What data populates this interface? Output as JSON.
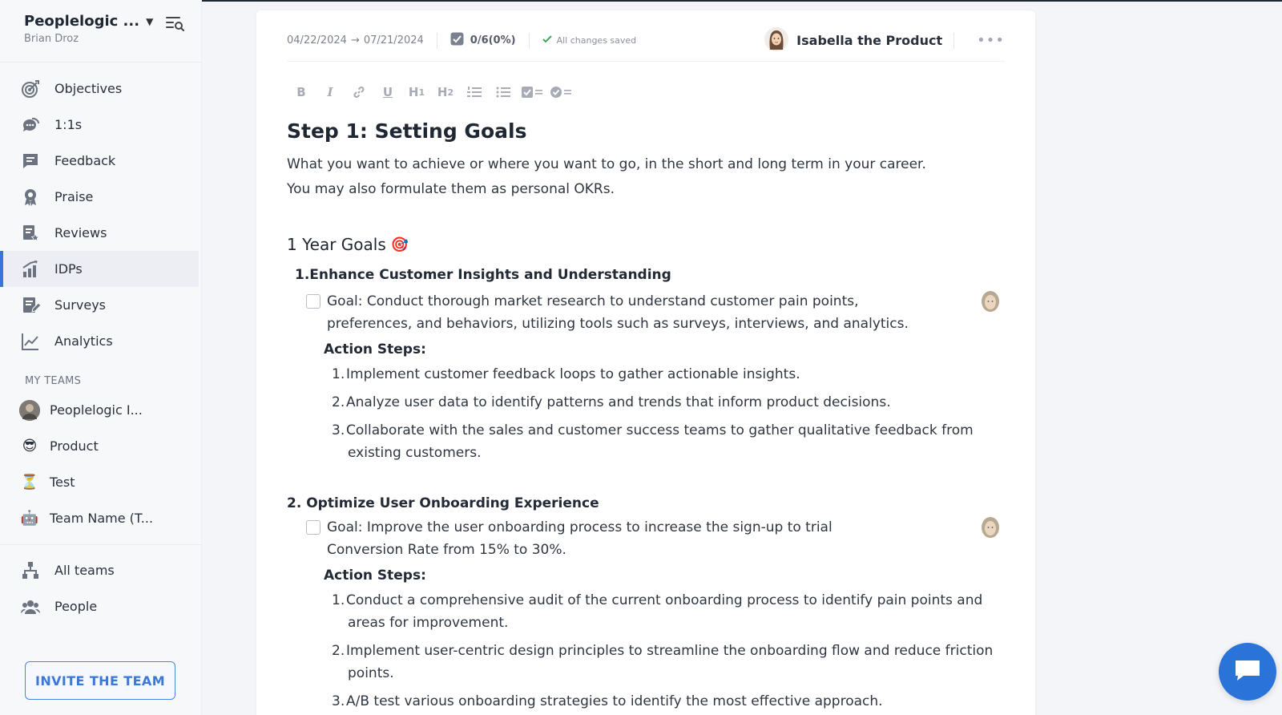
{
  "workspace": {
    "name": "Peoplelogic ...",
    "user": "Brian Droz"
  },
  "nav": {
    "items": [
      {
        "label": "Objectives",
        "icon": "target-icon"
      },
      {
        "label": "1:1s",
        "icon": "chat-bubbles-icon"
      },
      {
        "label": "Feedback",
        "icon": "feedback-icon"
      },
      {
        "label": "Praise",
        "icon": "award-icon"
      },
      {
        "label": "Reviews",
        "icon": "review-icon"
      },
      {
        "label": "IDPs",
        "icon": "growth-chart-icon",
        "active": true
      },
      {
        "label": "Surveys",
        "icon": "survey-icon"
      },
      {
        "label": "Analytics",
        "icon": "line-chart-icon"
      }
    ]
  },
  "teams": {
    "title": "MY TEAMS",
    "items": [
      {
        "label": "Peoplelogic I...",
        "avatar": "photo"
      },
      {
        "label": "Product",
        "avatar": "😎"
      },
      {
        "label": "Test",
        "avatar": "⏳"
      },
      {
        "label": "Team Name (T...",
        "avatar": "🤖"
      }
    ]
  },
  "bottom_nav": {
    "items": [
      {
        "label": "All teams",
        "icon": "org-chart-icon"
      },
      {
        "label": "People",
        "icon": "people-icon"
      }
    ]
  },
  "invite": {
    "label": "INVITE THE TEAM"
  },
  "doc_header": {
    "start_date": "04/22/2024",
    "end_date": "07/21/2024",
    "progress": "0/6(0%)",
    "saved": "All changes saved",
    "owner": "Isabella the Product",
    "more": "•••"
  },
  "toolbar": [
    "B",
    "I",
    "link",
    "U",
    "H1",
    "H2",
    "ordered-list",
    "bullet-list",
    "checklist",
    "done-list"
  ],
  "doc": {
    "title": "Step 1: Setting Goals",
    "intro_1": "What you want to achieve or where you want to go, in the short and long term in your career.",
    "intro_2": "You may also formulate them as personal OKRs.",
    "section": "1 Year Goals",
    "section_emoji": "🎯",
    "goals": [
      {
        "num": "1.",
        "title": "Enhance Customer Insights and Understanding",
        "task_1": "Goal: Conduct thorough market research to understand customer pain points,",
        "task_2": "preferences, and behaviors, utilizing tools such as surveys, interviews, and analytics.",
        "steps_title": "Action Steps:",
        "steps": [
          {
            "num": "1.",
            "l1": "Implement customer feedback loops to gather actionable insights.",
            "l2": ""
          },
          {
            "num": "2.",
            "l1": "Analyze user data to identify patterns and trends that inform product decisions.",
            "l2": ""
          },
          {
            "num": "3.",
            "l1": "Collaborate with the sales and customer success teams to gather qualitative feedback from",
            "l2": "existing customers."
          }
        ]
      },
      {
        "num": "2.",
        "title": "Optimize User Onboarding Experience",
        "task_1": "Goal: Improve the user onboarding process to increase the sign-up to trial",
        "task_2": "Conversion Rate from 15% to 30%.",
        "steps_title": "Action Steps:",
        "steps": [
          {
            "num": "1.",
            "l1": "Conduct a comprehensive audit of the current onboarding process to identify pain points and",
            "l2": "areas for improvement."
          },
          {
            "num": "2.",
            "l1": "Implement user-centric design principles to streamline the onboarding flow and reduce friction",
            "l2": "points."
          },
          {
            "num": "3.",
            "l1": "A/B test various onboarding strategies to identify the most effective approach.",
            "l2": ""
          }
        ]
      }
    ]
  },
  "colors": {
    "accent": "#3a74d8",
    "chat": "#2a74d9",
    "check": "#3fa85a"
  }
}
